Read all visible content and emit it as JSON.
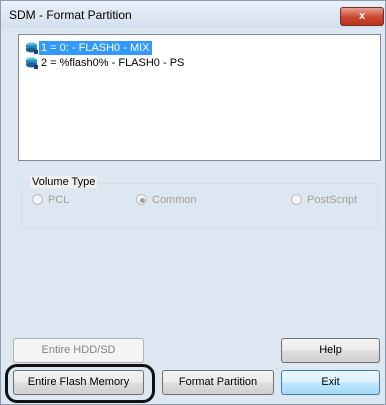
{
  "window": {
    "title": "SDM - Format Partition",
    "close_label": "x"
  },
  "partitions": [
    {
      "label": "1 = 0: - FLASH0 - MIX",
      "selected": true,
      "icon": "disk-icon"
    },
    {
      "label": "2 = %flash0% - FLASH0 - PS",
      "selected": false,
      "icon": "disk-icon"
    }
  ],
  "volume_type": {
    "legend": "Volume Type",
    "options": [
      {
        "label": "PCL",
        "checked": false,
        "enabled": false
      },
      {
        "label": "Common",
        "checked": true,
        "enabled": false
      },
      {
        "label": "PostScript",
        "checked": false,
        "enabled": false
      }
    ]
  },
  "buttons": {
    "entire_hdd_sd": "Entire HDD/SD",
    "help": "Help",
    "entire_flash_memory": "Entire Flash Memory",
    "format_partition": "Format Partition",
    "exit": "Exit"
  },
  "colors": {
    "selection": "#3399ff",
    "highlight_ring": "#111111"
  }
}
